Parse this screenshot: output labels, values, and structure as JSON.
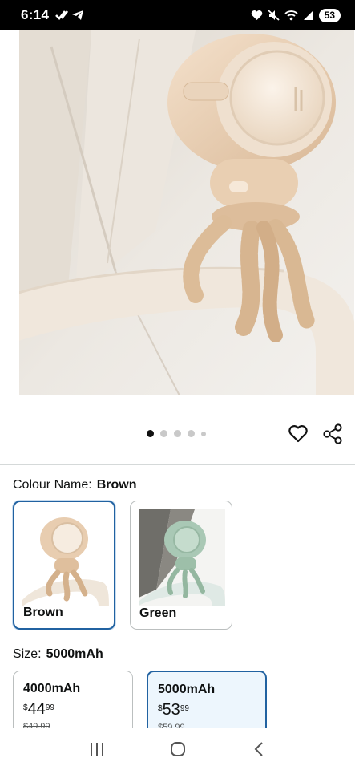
{
  "status_bar": {
    "time": "6:14",
    "battery": "53",
    "left_icons": [
      "check-icon",
      "telegram-icon"
    ],
    "right_icons": [
      "heart-icon",
      "mute-icon",
      "wifi-icon",
      "signal-icon"
    ]
  },
  "gallery": {
    "image_count": 5,
    "active_index": 0
  },
  "colour": {
    "label": "Colour Name:",
    "value": "Brown",
    "options": [
      {
        "label": "Brown",
        "selected": true
      },
      {
        "label": "Green",
        "selected": false
      }
    ]
  },
  "size": {
    "label": "Size:",
    "value": "5000mAh",
    "options": [
      {
        "title": "4000mAh",
        "currency": "$",
        "whole": "44",
        "fraction": "99",
        "list_price": "$49.99",
        "selected": false
      },
      {
        "title": "5000mAh",
        "currency": "$",
        "whole": "53",
        "fraction": "99",
        "list_price": "$59.99",
        "selected": true
      }
    ]
  },
  "colors": {
    "accent": "#2162a1",
    "selected_bg": "#edf6fd",
    "divider": "#d5d9d9"
  }
}
